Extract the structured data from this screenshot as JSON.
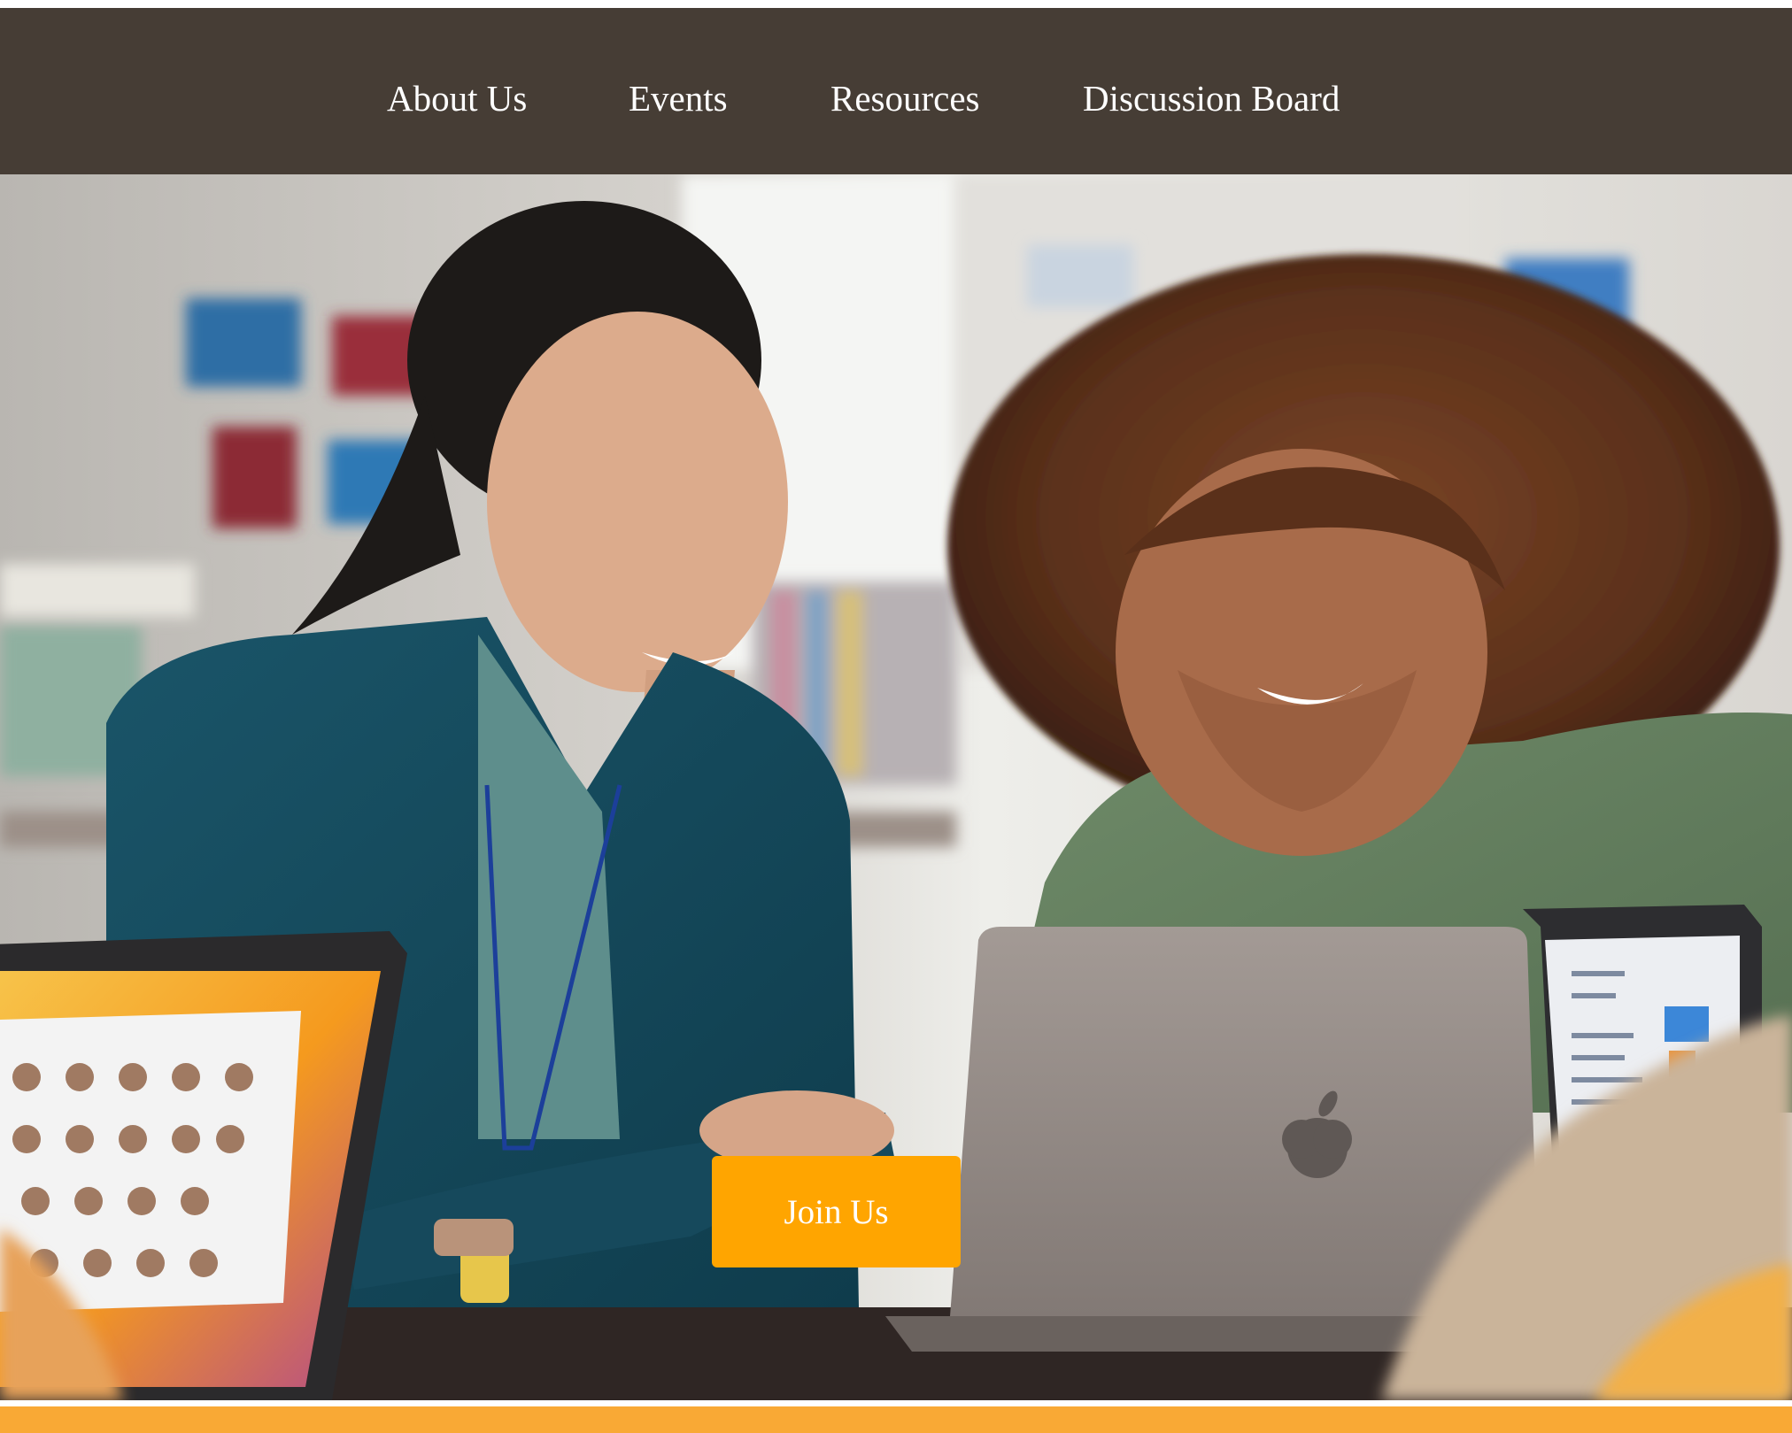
{
  "nav": {
    "items": [
      {
        "label": "About Us"
      },
      {
        "label": "Events"
      },
      {
        "label": "Resources"
      },
      {
        "label": "Discussion Board"
      }
    ]
  },
  "hero": {
    "cta_label": "Join Us",
    "cta_color": "#ffa500"
  },
  "colors": {
    "navbar_bg": "#463d35",
    "nav_text": "#ffffff",
    "bottom_strip": "#f9a935"
  }
}
